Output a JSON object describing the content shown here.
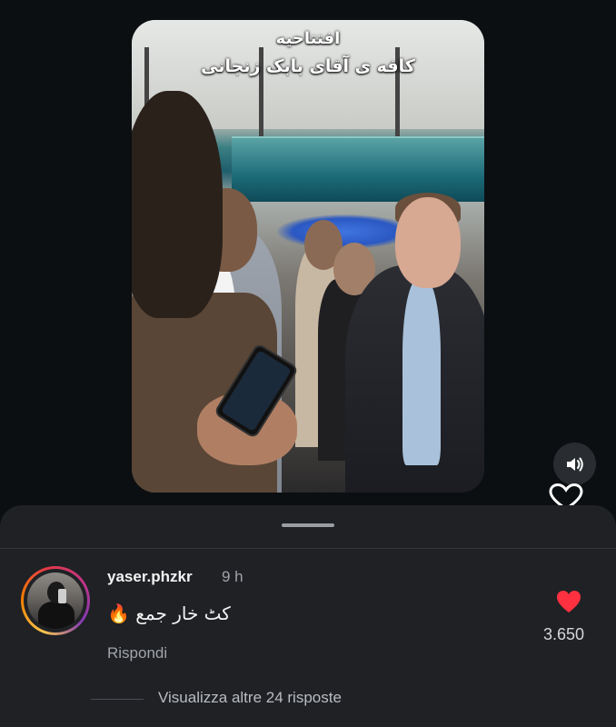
{
  "video": {
    "overlay_line1": "افتتاحیه",
    "overlay_line2": "کافه ی آقای بابک زنجانی",
    "sound_icon": "speaker-icon",
    "like_icon": "heart-outline-icon"
  },
  "comment": {
    "username": "yaser.phzkr",
    "time": "9 h",
    "text": "کٹ خار جمع 🔥",
    "reply_label": "Rispondi",
    "like_count": "3.650",
    "like_icon": "heart-filled-icon",
    "like_color": "#ff3040",
    "more_replies_label": "Visualizza altre 24 risposte"
  },
  "colors": {
    "background": "#0b0f12",
    "sheet": "#1f2125",
    "accent_like": "#ff3040"
  }
}
